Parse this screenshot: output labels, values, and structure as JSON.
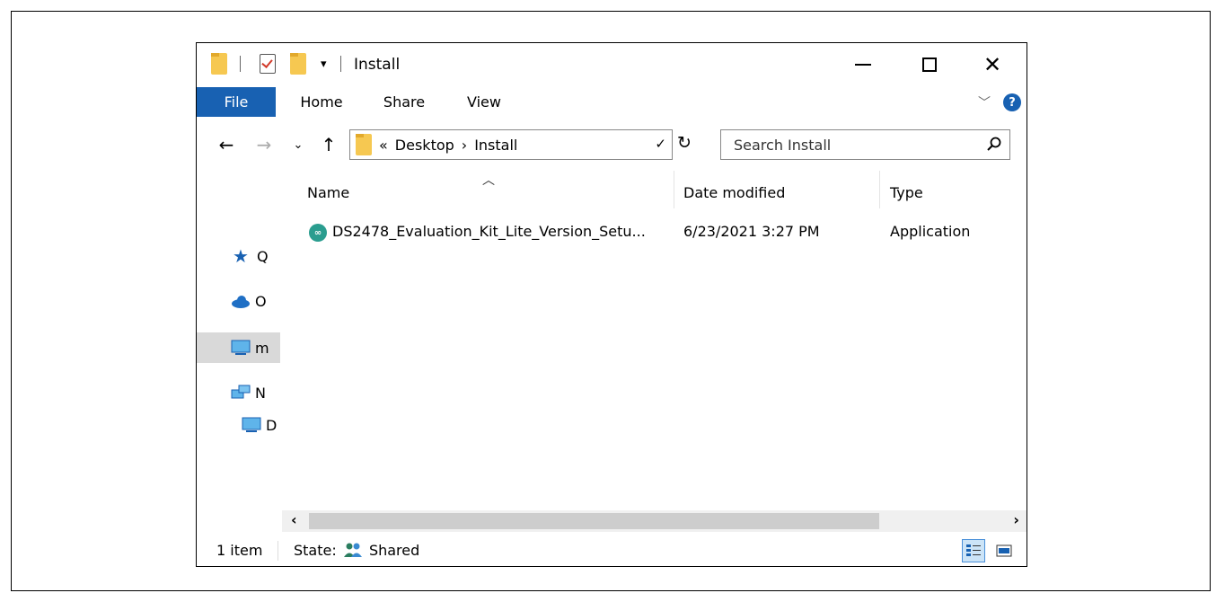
{
  "window": {
    "title": "Install"
  },
  "ribbon": {
    "tabs": [
      "File",
      "Home",
      "Share",
      "View"
    ]
  },
  "address": {
    "overflow": "«",
    "crumbs": [
      "Desktop",
      "Install"
    ],
    "separator": "›"
  },
  "search": {
    "placeholder": "Search Install"
  },
  "nav_pane": {
    "items": [
      "Q",
      "O",
      "m",
      "N",
      "D"
    ]
  },
  "file_list": {
    "columns": [
      "Name",
      "Date modified",
      "Type"
    ],
    "rows": [
      {
        "name": "DS2478_Evaluation_Kit_Lite_Version_Setu...",
        "date": "6/23/2021 3:27 PM",
        "type": "Application"
      }
    ]
  },
  "status": {
    "count": "1 item",
    "state_label": "State:",
    "state_value": "Shared"
  },
  "colors": {
    "accent": "#1861b2",
    "app_icon": "#2a9d8f",
    "folder": "#f6c851"
  }
}
